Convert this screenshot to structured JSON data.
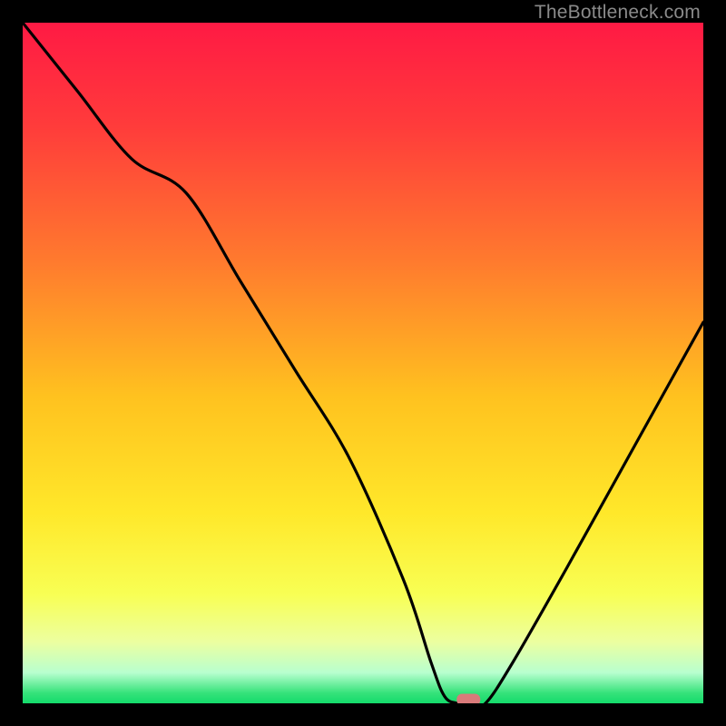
{
  "watermark": "TheBottleneck.com",
  "chart_data": {
    "type": "line",
    "title": "",
    "xlabel": "",
    "ylabel": "",
    "xlim": [
      0,
      100
    ],
    "ylim": [
      0,
      100
    ],
    "note": "y = bottleneck percentage (0 at bottom/green, 100 at top/red). Curve descends from top-left, dips to ~0 near x≈65, rises to right edge.",
    "series": [
      {
        "name": "bottleneck-curve",
        "x": [
          0,
          8,
          16,
          24,
          32,
          40,
          48,
          56,
          60,
          62,
          64,
          66,
          68,
          72,
          80,
          90,
          100
        ],
        "y": [
          100,
          90,
          80,
          75,
          62,
          49,
          36,
          18,
          6,
          1,
          0,
          0,
          0,
          6,
          20,
          38,
          56
        ]
      }
    ],
    "marker": {
      "x": 65.5,
      "y": 0,
      "color": "#d97a7a"
    },
    "gradient_stops": [
      {
        "offset": 0.0,
        "color": "#ff1a44"
      },
      {
        "offset": 0.15,
        "color": "#ff3b3b"
      },
      {
        "offset": 0.35,
        "color": "#ff7a2e"
      },
      {
        "offset": 0.55,
        "color": "#ffc21f"
      },
      {
        "offset": 0.72,
        "color": "#ffe82a"
      },
      {
        "offset": 0.84,
        "color": "#f8ff54"
      },
      {
        "offset": 0.91,
        "color": "#ecffa0"
      },
      {
        "offset": 0.955,
        "color": "#b8ffcf"
      },
      {
        "offset": 0.985,
        "color": "#35e27a"
      },
      {
        "offset": 1.0,
        "color": "#14db6b"
      }
    ]
  }
}
